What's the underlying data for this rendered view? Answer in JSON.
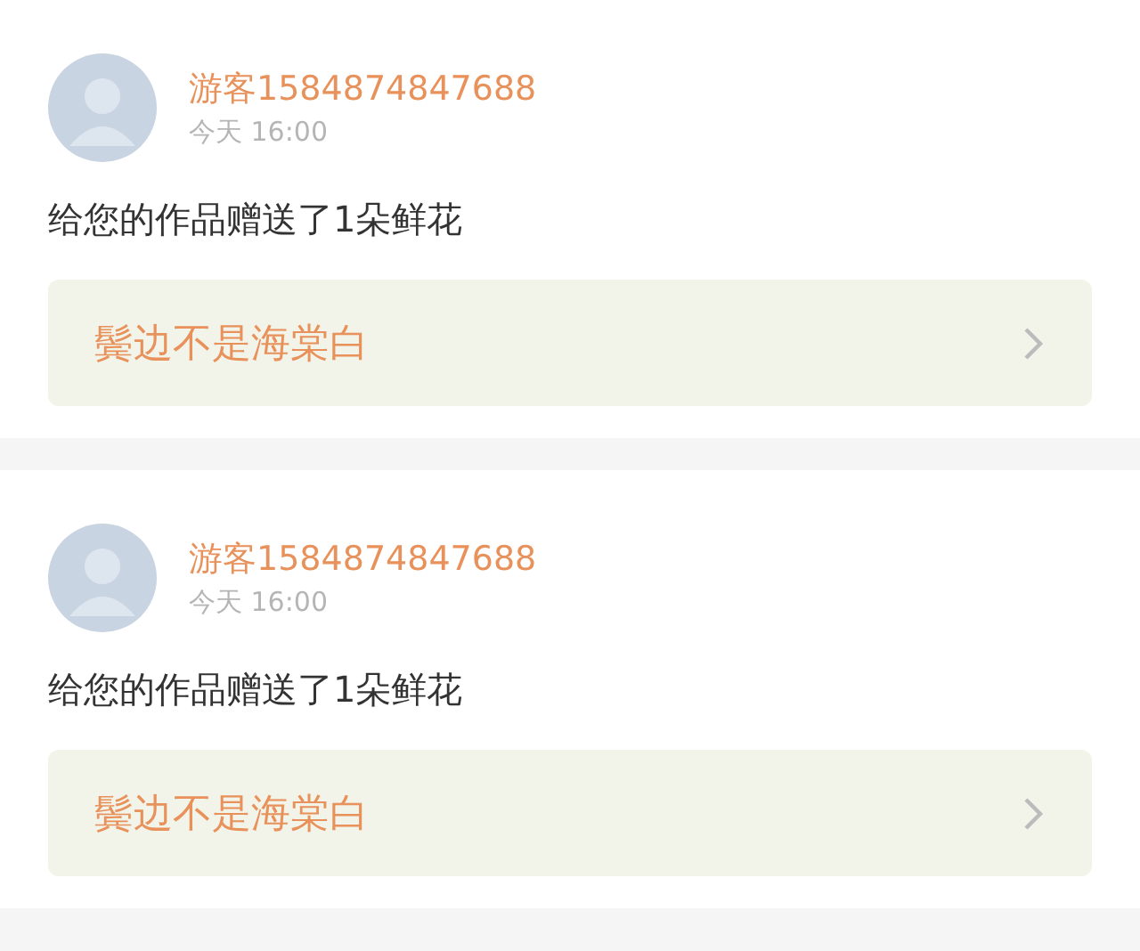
{
  "notifications": [
    {
      "user": "游客1584874847688",
      "time": "今天 16:00",
      "message": "给您的作品赠送了1朵鲜花",
      "work_title": "鬓边不是海棠白"
    },
    {
      "user": "游客1584874847688",
      "time": "今天 16:00",
      "message": "给您的作品赠送了1朵鲜花",
      "work_title": "鬓边不是海棠白"
    }
  ]
}
